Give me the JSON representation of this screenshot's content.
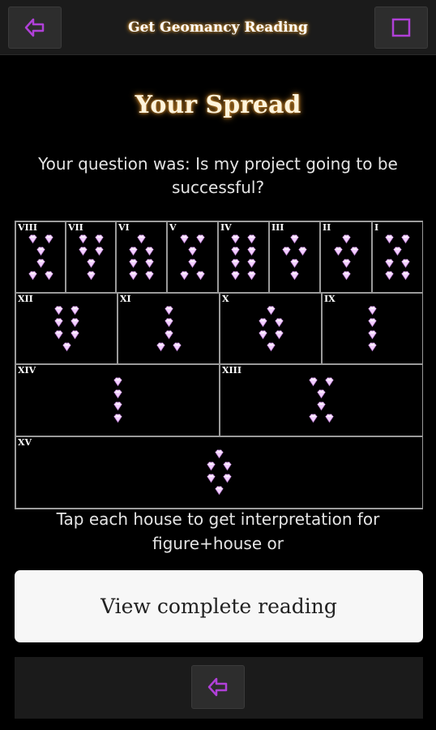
{
  "header": {
    "title": "Get Geomancy Reading",
    "back_icon": "back-arrow-icon",
    "menu_icon": "square-menu-icon"
  },
  "main": {
    "heading": "Your Spread",
    "question": "Your question was: Is my project going to be successful?",
    "instruction": "Tap each house to get interpretation for figure+house or",
    "view_button": "View complete reading"
  },
  "spread": {
    "houses": [
      {
        "numeral": "VIII",
        "figure": [
          2,
          1,
          1,
          2
        ]
      },
      {
        "numeral": "VII",
        "figure": [
          2,
          2,
          1,
          1
        ]
      },
      {
        "numeral": "VI",
        "figure": [
          1,
          2,
          2,
          2
        ]
      },
      {
        "numeral": "V",
        "figure": [
          2,
          1,
          1,
          2
        ]
      },
      {
        "numeral": "IV",
        "figure": [
          2,
          2,
          2,
          2
        ]
      },
      {
        "numeral": "III",
        "figure": [
          1,
          2,
          1,
          1
        ]
      },
      {
        "numeral": "II",
        "figure": [
          1,
          2,
          1,
          1
        ]
      },
      {
        "numeral": "I",
        "figure": [
          2,
          1,
          2,
          2
        ]
      },
      {
        "numeral": "XII",
        "figure": [
          2,
          2,
          2,
          1
        ]
      },
      {
        "numeral": "XI",
        "figure": [
          1,
          1,
          1,
          2
        ]
      },
      {
        "numeral": "X",
        "figure": [
          1,
          2,
          2,
          1
        ]
      },
      {
        "numeral": "IX",
        "figure": [
          1,
          1,
          1,
          1
        ]
      },
      {
        "numeral": "XIV",
        "figure": [
          1,
          1,
          1,
          1
        ]
      },
      {
        "numeral": "XIII",
        "figure": [
          2,
          1,
          1,
          2
        ]
      },
      {
        "numeral": "XV",
        "figure": [
          1,
          2,
          2,
          1
        ]
      }
    ]
  },
  "footer": {
    "back_icon": "back-arrow-icon"
  },
  "colors": {
    "accent_purple": "#b040d8",
    "gem": "#f3d0ff",
    "glow": "#d08a2a"
  }
}
